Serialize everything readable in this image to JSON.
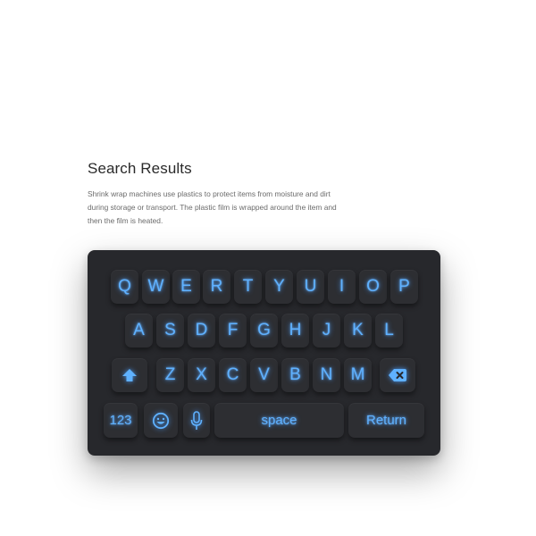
{
  "content": {
    "title": "Search Results",
    "description": "Shrink wrap machines use plastics to protect items from moisture and dirt during storage or transport. The plastic film is wrapped around the item and then the film is heated."
  },
  "keyboard": {
    "accent_color": "#5fb1ff",
    "background_color": "#27282c",
    "row1": [
      "Q",
      "W",
      "E",
      "R",
      "T",
      "Y",
      "U",
      "I",
      "O",
      "P"
    ],
    "row2": [
      "A",
      "S",
      "D",
      "F",
      "G",
      "H",
      "J",
      "K",
      "L"
    ],
    "row3": [
      "Z",
      "X",
      "C",
      "V",
      "B",
      "N",
      "M"
    ],
    "shift_icon": "shift-icon",
    "backspace_icon": "backspace-icon",
    "numbers_label": "123",
    "emoji_icon": "emoji-icon",
    "mic_icon": "microphone-icon",
    "space_label": "space",
    "return_label": "Return"
  }
}
